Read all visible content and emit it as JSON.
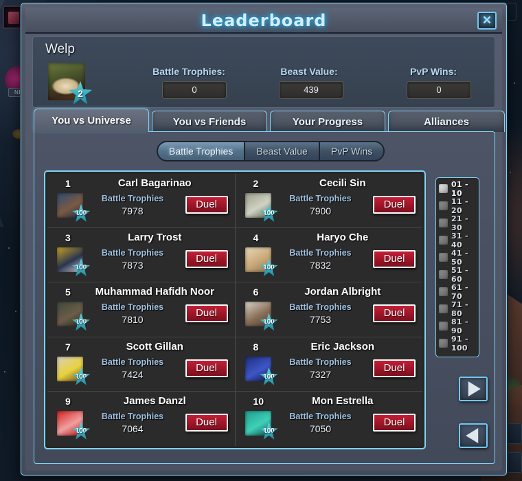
{
  "window": {
    "title": "Leaderboard",
    "close_icon": "close-icon",
    "close_glyph": "✕"
  },
  "profile": {
    "player_name": "Welp",
    "level": "2",
    "avatar_icon": "lion-cub-avatar",
    "stats": [
      {
        "label": "Battle Trophies:",
        "value": "0"
      },
      {
        "label": "Beast Value:",
        "value": "439"
      },
      {
        "label": "PvP Wins:",
        "value": "0"
      }
    ]
  },
  "tabs": [
    {
      "label": "You vs Universe",
      "active": true
    },
    {
      "label": "You vs Friends",
      "active": false
    },
    {
      "label": "Your Progress",
      "active": false
    },
    {
      "label": "Alliances",
      "active": false
    }
  ],
  "segmented": [
    {
      "label": "Battle Trophies",
      "selected": true
    },
    {
      "label": "Beast Value",
      "selected": false
    },
    {
      "label": "PvP Wins",
      "selected": false
    }
  ],
  "leaderboard": {
    "stat_name": "Battle Trophies",
    "duel_label": "Duel",
    "badge_value": "100",
    "entries": [
      {
        "rank": "1",
        "name": "Carl Bagarinao",
        "stat_label": "Battle Trophies",
        "score": "7978",
        "badge": "100",
        "duel": "Duel",
        "avatar": "#2e4a72,#7a5a43,#1b2b45"
      },
      {
        "rank": "2",
        "name": "Cecili Sin",
        "stat_label": "Battle Trophies",
        "score": "7900",
        "badge": "100",
        "duel": "Duel",
        "avatar": "#9a9e8a,#cfd3c2,#5e6452"
      },
      {
        "rank": "3",
        "name": "Larry Trost",
        "stat_label": "Battle Trophies",
        "score": "7873",
        "badge": "100",
        "duel": "Duel",
        "avatar": "#c9a227,#2a3550,#d4d8e0"
      },
      {
        "rank": "4",
        "name": "Haryo Che",
        "stat_label": "Battle Trophies",
        "score": "7832",
        "badge": "100",
        "duel": "Duel",
        "avatar": "#e8d9b8,#c9a877,#8a7450"
      },
      {
        "rank": "5",
        "name": "Muhammad Hafidh Noor",
        "stat_label": "Battle Trophies",
        "score": "7810",
        "badge": "100",
        "duel": "Duel",
        "avatar": "#3d4a3a,#6b5c48,#242c22"
      },
      {
        "rank": "6",
        "name": "Jordan Albright",
        "stat_label": "Battle Trophies",
        "score": "7753",
        "badge": "100",
        "duel": "Duel",
        "avatar": "#d8d4cb,#8a6f57,#4a4038"
      },
      {
        "rank": "7",
        "name": "Scott Gillan",
        "stat_label": "Battle Trophies",
        "score": "7424",
        "badge": "100",
        "duel": "Duel",
        "avatar": "#d9cfc0,#e8d23c,#6b4a2a"
      },
      {
        "rank": "8",
        "name": "Eric Jackson",
        "stat_label": "Battle Trophies",
        "score": "7327",
        "badge": "100",
        "duel": "Duel",
        "avatar": "#1f2f7a,#3d56c9,#101a3a"
      },
      {
        "rank": "9",
        "name": "James Danzl",
        "stat_label": "Battle Trophies",
        "score": "7064",
        "badge": "100",
        "duel": "Duel",
        "avatar": "#d61f1f,#f0a0a0,#b01010"
      },
      {
        "rank": "10",
        "name": "Mon Estrella",
        "stat_label": "Battle Trophies",
        "score": "7050",
        "badge": "100",
        "duel": "Duel",
        "avatar": "#1f9e8e,#3fd0b8,#0d4a44"
      }
    ]
  },
  "rank_ranges": [
    {
      "label": "01 - 10",
      "selected": true
    },
    {
      "label": "11 - 20",
      "selected": false
    },
    {
      "label": "21 - 30",
      "selected": false
    },
    {
      "label": "31 - 40",
      "selected": false
    },
    {
      "label": "41 - 50",
      "selected": false
    },
    {
      "label": "51 - 60",
      "selected": false
    },
    {
      "label": "61 - 70",
      "selected": false
    },
    {
      "label": "71 - 80",
      "selected": false
    },
    {
      "label": "81 - 90",
      "selected": false
    },
    {
      "label": "91 - 100",
      "selected": false
    }
  ],
  "nav": {
    "next_icon": "arrow-right-icon",
    "prev_icon": "arrow-left-icon"
  },
  "background": {
    "sign_text": "NE"
  },
  "colors": {
    "accent_cyan": "#7fd4f5",
    "duel_red": "#c31f36",
    "badge_teal": "#5fd3e0",
    "stat_blue": "#9fc0df"
  }
}
